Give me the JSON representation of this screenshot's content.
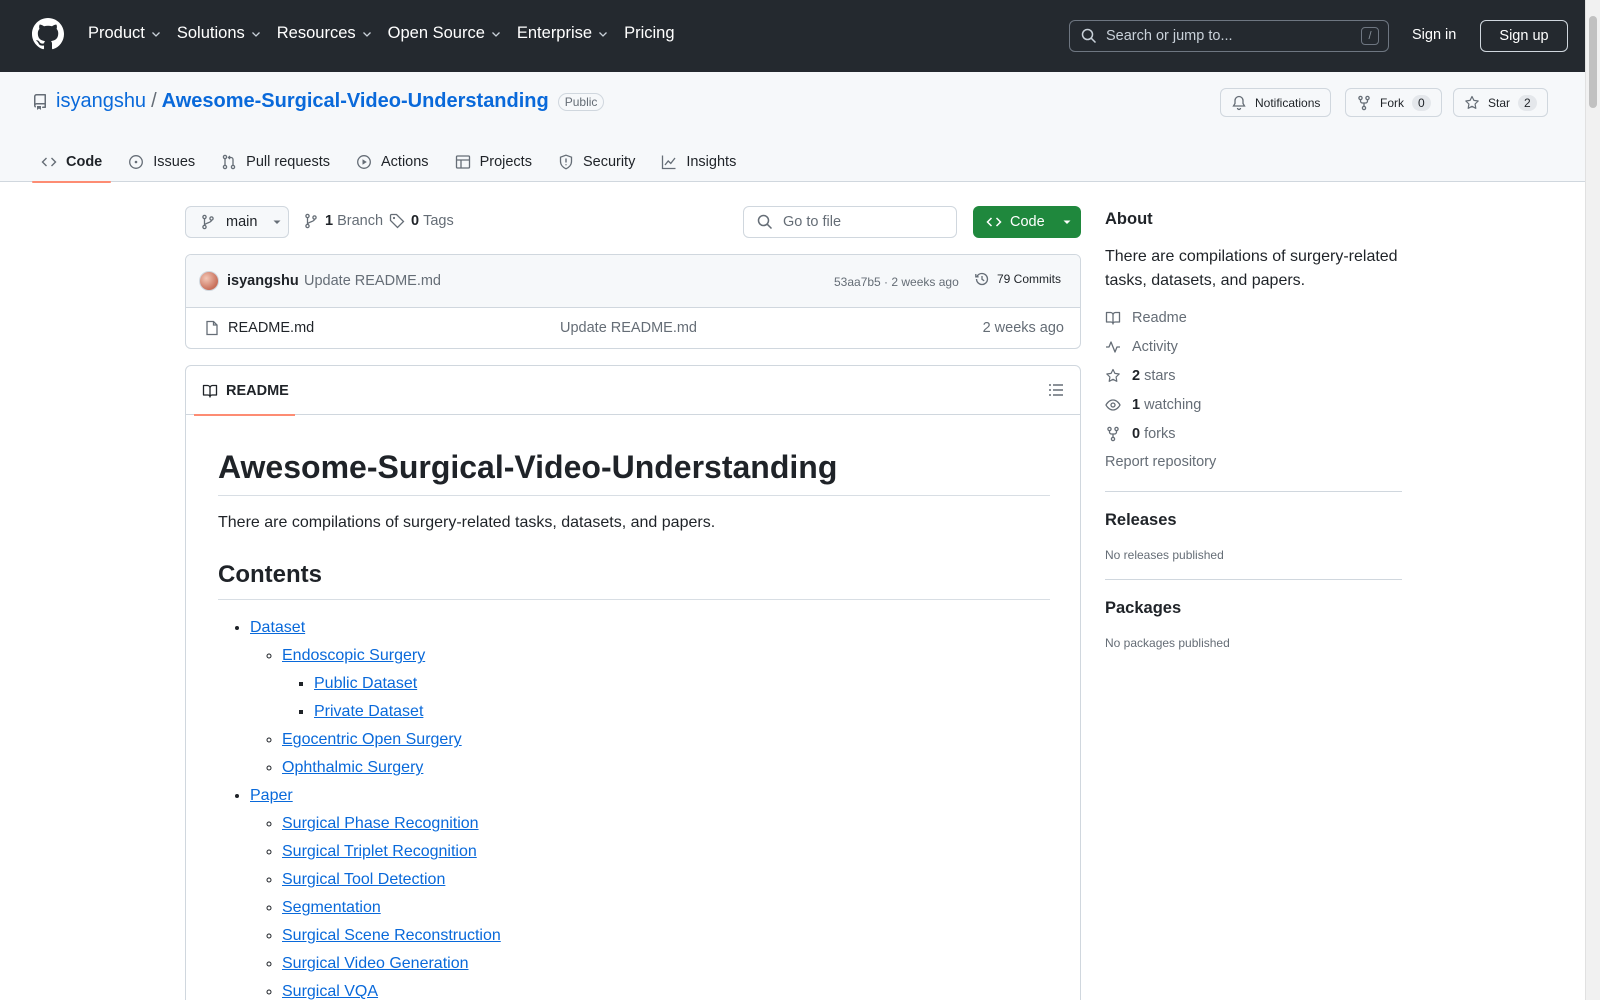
{
  "header": {
    "nav": [
      {
        "label": "Product",
        "has_menu": true
      },
      {
        "label": "Solutions",
        "has_menu": true
      },
      {
        "label": "Resources",
        "has_menu": true
      },
      {
        "label": "Open Source",
        "has_menu": true
      },
      {
        "label": "Enterprise",
        "has_menu": true
      },
      {
        "label": "Pricing",
        "has_menu": false
      }
    ],
    "search_placeholder": "Search or jump to...",
    "search_shortcut": "/",
    "sign_in": "Sign in",
    "sign_up": "Sign up"
  },
  "repo": {
    "owner": "isyangshu",
    "separator": "/",
    "name": "Awesome-Surgical-Video-Understanding",
    "visibility": "Public",
    "notifications_label": "Notifications",
    "fork_label": "Fork",
    "fork_count": "0",
    "star_label": "Star",
    "star_count": "2"
  },
  "tabs": [
    {
      "label": "Code",
      "icon": "code-icon",
      "active": true
    },
    {
      "label": "Issues",
      "icon": "issue-icon"
    },
    {
      "label": "Pull requests",
      "icon": "pull-request-icon"
    },
    {
      "label": "Actions",
      "icon": "play-icon"
    },
    {
      "label": "Projects",
      "icon": "table-icon"
    },
    {
      "label": "Security",
      "icon": "shield-icon"
    },
    {
      "label": "Insights",
      "icon": "graph-icon"
    }
  ],
  "file_nav": {
    "branch": "main",
    "branch_count": "1",
    "branch_label": "Branch",
    "tag_count": "0",
    "tag_label": "Tags",
    "goto_placeholder": "Go to file",
    "code_button": "Code"
  },
  "commit": {
    "author": "isyangshu",
    "message": "Update README.md",
    "sha_age": "53aa7b5 · 2 weeks ago",
    "count_label": "79 Commits"
  },
  "files": [
    {
      "name": "README.md",
      "message": "Update README.md",
      "age": "2 weeks ago"
    }
  ],
  "readme": {
    "tab_label": "README",
    "title": "Awesome-Surgical-Video-Understanding",
    "intro": "There are compilations of surgery-related tasks, datasets, and papers.",
    "contents_heading": "Contents",
    "toc": {
      "dataset": "Dataset",
      "endoscopic": "Endoscopic Surgery",
      "public_dataset": "Public Dataset",
      "private_dataset": "Private Dataset",
      "egocentric": "Egocentric Open Surgery",
      "ophthalmic": "Ophthalmic Surgery",
      "paper": "Paper",
      "papers": [
        "Surgical Phase Recognition",
        "Surgical Triplet Recognition",
        "Surgical Tool Detection",
        "Segmentation",
        "Surgical Scene Reconstruction",
        "Surgical Video Generation",
        "Surgical VQA"
      ]
    }
  },
  "sidebar": {
    "about_heading": "About",
    "description": "There are compilations of surgery-related tasks, datasets, and papers.",
    "readme": "Readme",
    "activity": "Activity",
    "stars_count": "2",
    "stars_label": "stars",
    "watching_count": "1",
    "watching_label": "watching",
    "forks_count": "0",
    "forks_label": "forks",
    "report": "Report repository",
    "releases_heading": "Releases",
    "releases_empty": "No releases published",
    "packages_heading": "Packages",
    "packages_empty": "No packages published"
  },
  "colors": {
    "header_bg": "#24292f",
    "link": "#0969da",
    "primary_button": "#1f883d",
    "active_tab_underline": "#fd8c73",
    "muted_text": "#656d76",
    "border": "#d0d7de"
  }
}
